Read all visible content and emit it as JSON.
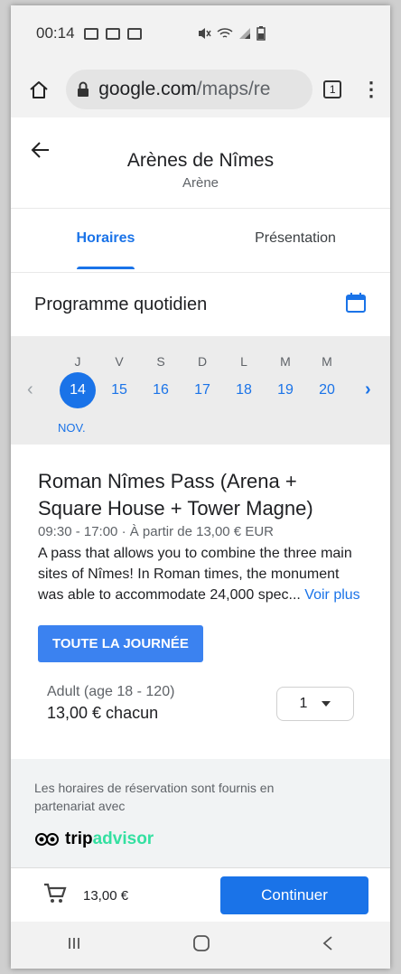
{
  "status_bar": {
    "time": "00:14"
  },
  "browser": {
    "url_host": "google.com",
    "url_path": "/maps/re",
    "tab_count": "1"
  },
  "place": {
    "title": "Arènes de Nîmes",
    "subtitle": "Arène"
  },
  "tabs": [
    {
      "label": "Horaires",
      "active": true
    },
    {
      "label": "Présentation",
      "active": false
    }
  ],
  "schedule": {
    "title": "Programme quotidien",
    "days": [
      "J",
      "V",
      "S",
      "D",
      "L",
      "M",
      "M"
    ],
    "dates": [
      "14",
      "15",
      "16",
      "17",
      "18",
      "19",
      "20"
    ],
    "selected_index": 0,
    "month": "NOV."
  },
  "product": {
    "title": "Roman Nîmes Pass (Arena + Square House + Tower Magne)",
    "meta": "09:30 - 17:00 · À partir de 13,00 € EUR",
    "description": "A pass that allows you to combine the three main sites of Nîmes! In Roman times, the monument was able to accommodate 24,000 spec...",
    "more_link": "Voir plus",
    "time_slot_button": "TOUTE LA JOURNÉE"
  },
  "ticket": {
    "label": "Adult (age 18 - 120)",
    "price": "13,00 € chacun",
    "quantity": "1"
  },
  "partner": {
    "text": "Les horaires de réservation sont fournis en partenariat avec",
    "brand_part1": "trip",
    "brand_part2": "advisor"
  },
  "cart": {
    "total": "13,00 €",
    "continue_label": "Continuer"
  },
  "colors": {
    "accent": "#1a73e8",
    "tripadvisor": "#34e0a1"
  }
}
